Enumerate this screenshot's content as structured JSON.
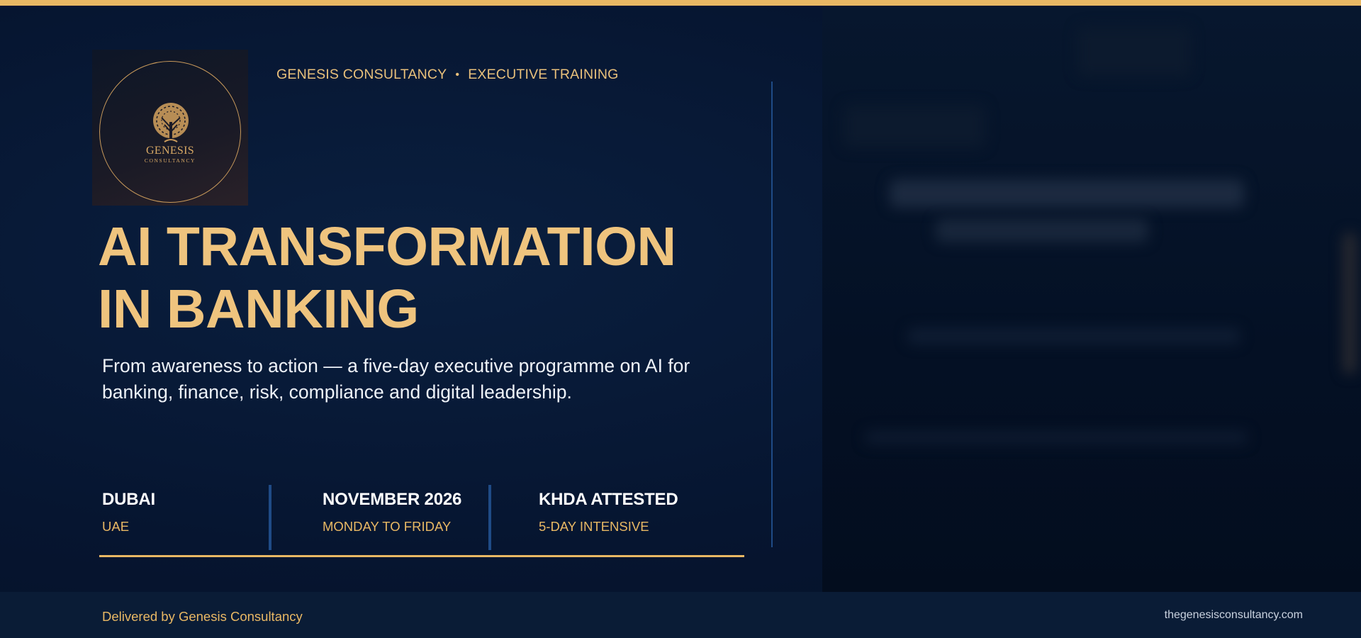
{
  "brand": {
    "logo_name": "GENESIS",
    "logo_sub": "CONSULTANCY",
    "org": "GENESIS CONSULTANCY",
    "separator": "•",
    "category": "EXECUTIVE TRAINING"
  },
  "hero": {
    "title_line1": "AI TRANSFORMATION",
    "title_line2": "IN BANKING",
    "subtitle": "From awareness to action — a five-day executive programme on AI for banking, finance, risk, compliance and digital leadership."
  },
  "facts": [
    {
      "label": "DUBAI",
      "sub": "UAE"
    },
    {
      "label": "NOVEMBER 2026",
      "sub": "MONDAY TO FRIDAY"
    },
    {
      "label": "KHDA ATTESTED",
      "sub": "5-DAY INTENSIVE"
    }
  ],
  "footer": {
    "left": "Delivered by Genesis Consultancy",
    "right": "thegenesisconsultancy.com"
  },
  "colors": {
    "accent": "#e9b864",
    "title": "#efc47e",
    "background": "#06152c",
    "divider": "#1f4b86",
    "footer_bg": "#0a1c36"
  }
}
